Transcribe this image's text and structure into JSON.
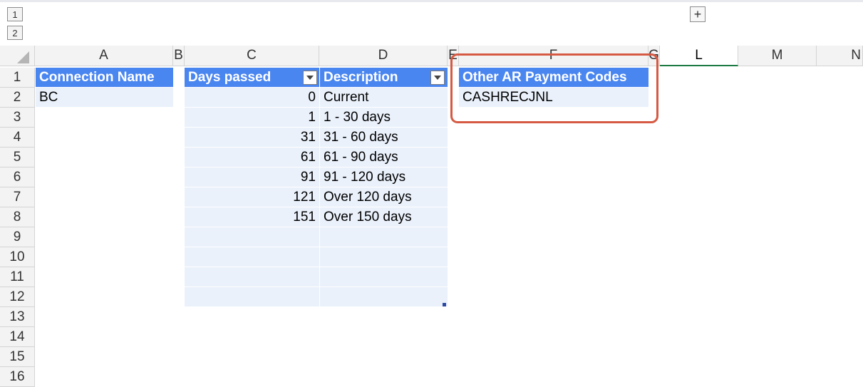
{
  "outline": {
    "levels": [
      "1",
      "2"
    ],
    "expand_glyph": "+"
  },
  "columns": [
    "A",
    "B",
    "C",
    "D",
    "E",
    "F",
    "G",
    "L",
    "M",
    "N"
  ],
  "rows": [
    "1",
    "2",
    "3",
    "4",
    "5",
    "6",
    "7",
    "8",
    "9",
    "10",
    "11",
    "12",
    "13",
    "14",
    "15",
    "16"
  ],
  "table_connection": {
    "header": "Connection Name",
    "values": [
      "BC"
    ]
  },
  "table_aging": {
    "headers": [
      "Days passed",
      "Description"
    ],
    "rows": [
      [
        "0",
        "Current"
      ],
      [
        "1",
        "1 - 30 days"
      ],
      [
        "31",
        "31 - 60 days"
      ],
      [
        "61",
        "61 - 90 days"
      ],
      [
        "91",
        "91 - 120 days"
      ],
      [
        "121",
        "Over 120 days"
      ],
      [
        "151",
        "Over 150 days"
      ]
    ]
  },
  "table_payment_codes": {
    "header": "Other AR Payment Codes",
    "values": [
      "CASHRECJNL"
    ]
  },
  "colors": {
    "table_header": "#4a86f0",
    "table_band": "#eaf1fb",
    "highlight": "#d65a43",
    "selected_column_underline": "#1e7a43"
  }
}
